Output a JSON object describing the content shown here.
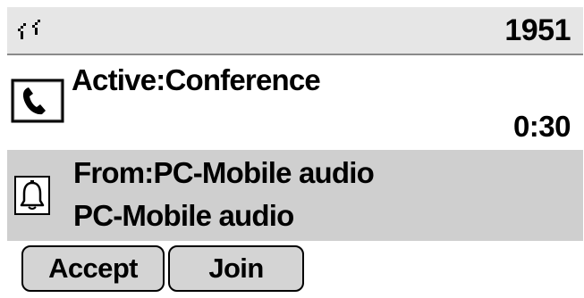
{
  "header": {
    "network_icon": "network-activity-icon",
    "extension": "1951"
  },
  "active_call": {
    "icon": "handset-icon",
    "title": "Active:Conference",
    "timer": "0:30"
  },
  "incoming_call": {
    "icon": "bell-icon",
    "from_line": "From:PC-Mobile audio",
    "name_line": "PC-Mobile audio"
  },
  "softkeys": {
    "accept_label": "Accept",
    "join_label": "Join"
  },
  "colors": {
    "header_bg": "#e6e6e6",
    "incoming_bg": "#cfcfcf",
    "softkey_bg": "#d4d4d4",
    "text": "#000000"
  }
}
